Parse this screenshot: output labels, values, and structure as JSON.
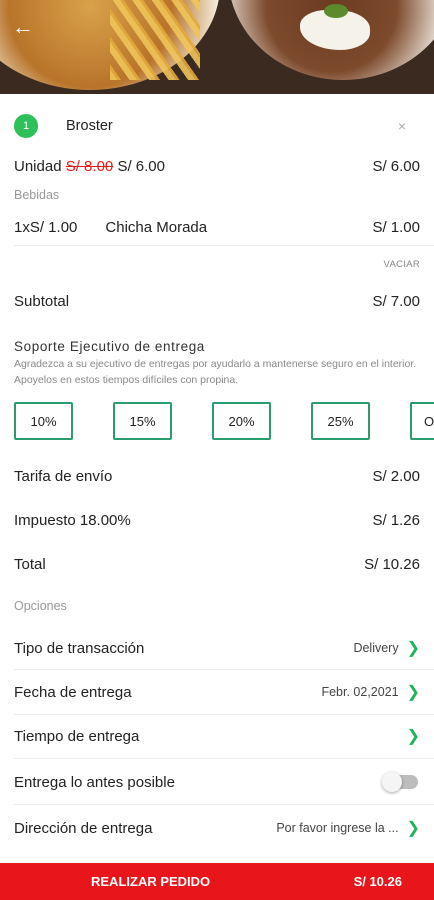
{
  "cart": {
    "item_count": "1",
    "item_name": "Broster",
    "close_symbol": "×",
    "unit_label": "Unidad",
    "unit_old_price": "S/ 8.00",
    "unit_new_price": "S/ 6.00",
    "unit_total": "S/ 6.00",
    "beverages_label": "Bebidas",
    "beverage_qty": "1xS/ 1.00",
    "beverage_name": "Chicha Morada",
    "beverage_total": "S/ 1.00",
    "empty_label": "VACIAR",
    "subtotal_label": "Subtotal",
    "subtotal_value": "S/ 7.00"
  },
  "tip": {
    "title": "Soporte Ejecutivo de entrega",
    "description": "Agradezca a su ejecutivo de entregas por ayudarlo a mantenerse seguro en el interior. Apoyelos en estos tiempos difíciles con propina.",
    "options": [
      "10%",
      "15%",
      "20%",
      "25%",
      "Otr"
    ]
  },
  "charges": {
    "shipping_label": "Tarifa de envío",
    "shipping_value": "S/ 2.00",
    "tax_label": "Impuesto 18.00%",
    "tax_value": "S/ 1.26",
    "total_label": "Total",
    "total_value": "S/ 10.26"
  },
  "options": {
    "section_label": "Opciones",
    "transaction_label": "Tipo de transacción",
    "transaction_value": "Delivery",
    "date_label": "Fecha de entrega",
    "date_value": "Febr. 02,2021",
    "time_label": "Tiempo de entrega",
    "time_value": "",
    "asap_label": "Entrega lo antes posible",
    "asap_enabled": false,
    "address_label": "Dirección de entrega",
    "address_value": "Por favor ingrese la ..."
  },
  "order_button": {
    "label": "REALIZAR PEDIDO",
    "amount": "S/ 10.26"
  },
  "colors": {
    "accent_green": "#2ec05a",
    "tip_border": "#2a9d6f",
    "order_red": "#e8151a",
    "strike_red": "#e0201b"
  },
  "icons": {
    "back": "arrow-left-icon",
    "chevron": "chevron-right-icon"
  }
}
